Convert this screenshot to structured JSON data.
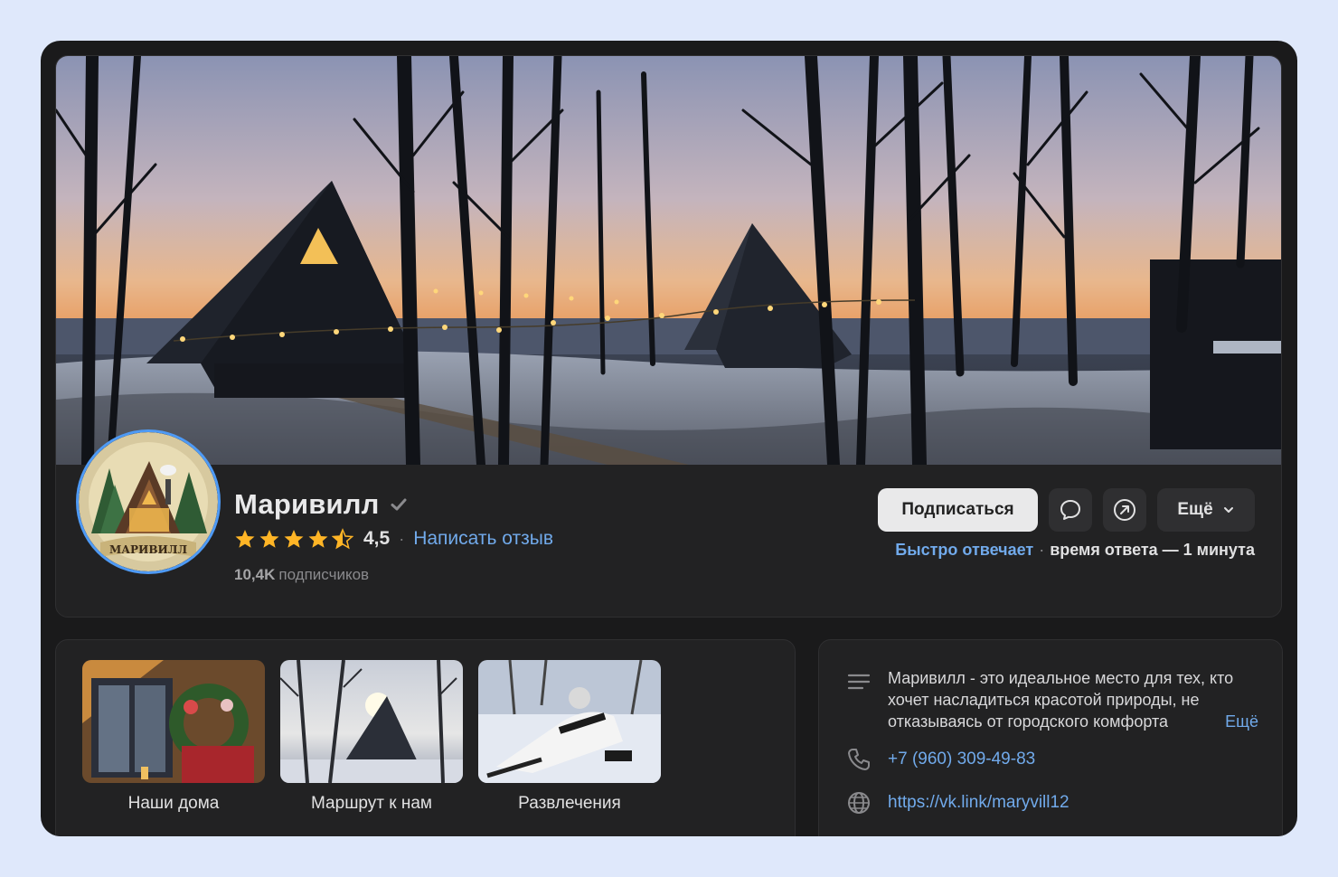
{
  "group": {
    "name": "Маривилл",
    "rating": "4,5",
    "rating_stars": 4.5,
    "review_link": "Написать отзыв",
    "subscribers_count": "10,4K",
    "subscribers_label": "подписчиков",
    "avatar_text": "МАРИВИЛЛ"
  },
  "actions": {
    "subscribe_label": "Подписаться",
    "message_icon": "chat-bubble-icon",
    "share_icon": "share-arrow-icon",
    "more_label": "Ещё"
  },
  "response": {
    "fast_label": "Быстро отвечает",
    "separator": "·",
    "time_label": "время ответа — 1 минута"
  },
  "albums": [
    {
      "label": "Наши дома"
    },
    {
      "label": "Маршрут к нам"
    },
    {
      "label": "Развлечения"
    }
  ],
  "info": {
    "description": "Маривилл - это идеальное место для тех, кто хочет насладиться красотой природы, не отказываясь от городского комфорта",
    "description_more": "Ещё",
    "phone": "+7 (960) 309-49-83",
    "website": "https://vk.link/maryvill12"
  },
  "colors": {
    "accent": "#71aaeb",
    "background": "#1a1a1b",
    "card": "#222223",
    "star": "#ffb526"
  }
}
